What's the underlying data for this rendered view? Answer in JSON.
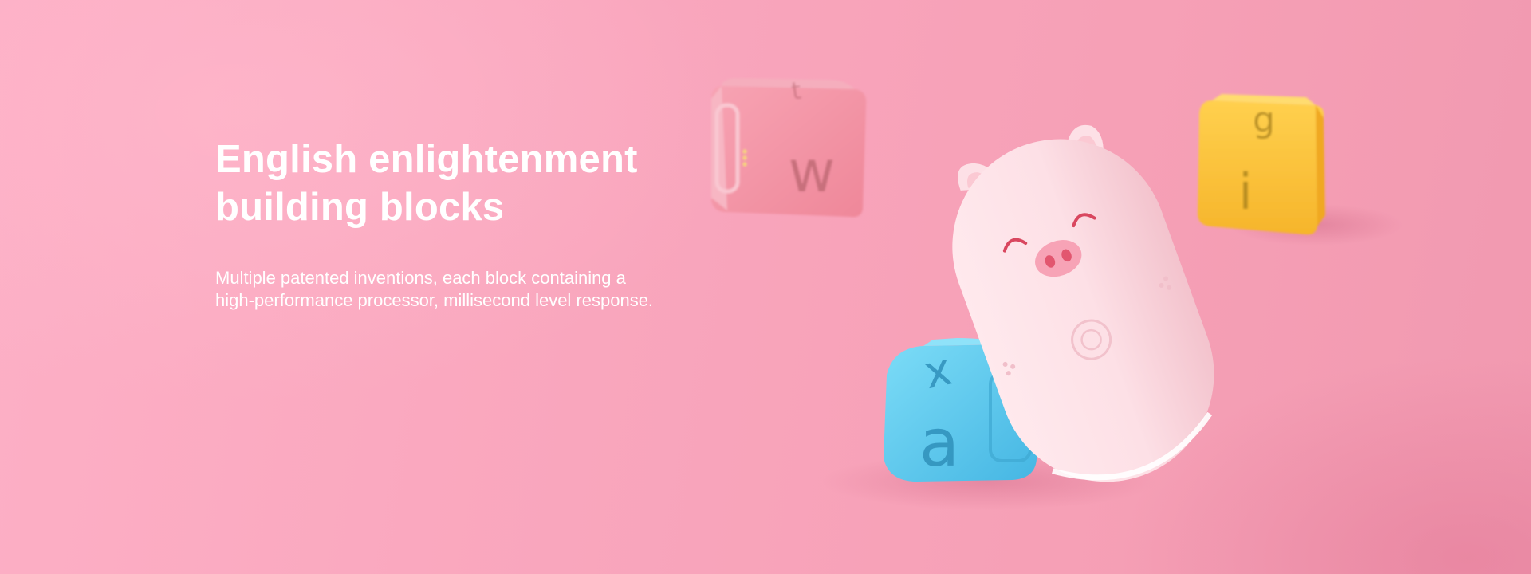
{
  "banner": {
    "headline_line1": "English enlightenment",
    "headline_line2": "building blocks",
    "subtext_line1": "Multiple patented inventions, each block containing a",
    "subtext_line2": "high-performance processor, millisecond level response."
  },
  "blocks": {
    "pink": {
      "letter_front": "w",
      "letter_top": "t",
      "color": "#f28fa4"
    },
    "yellow": {
      "letter_top": "g",
      "letter_front": "i",
      "color": "#fcc13b"
    },
    "blue": {
      "letter_top": "x",
      "letter_front": "a",
      "color": "#5ccbee"
    }
  },
  "colors": {
    "background": "#f8a5bb",
    "text": "#ffffff",
    "pig": "#fde1e6",
    "pig_nose": "#f38aa1",
    "pig_eye": "#d9475f"
  }
}
